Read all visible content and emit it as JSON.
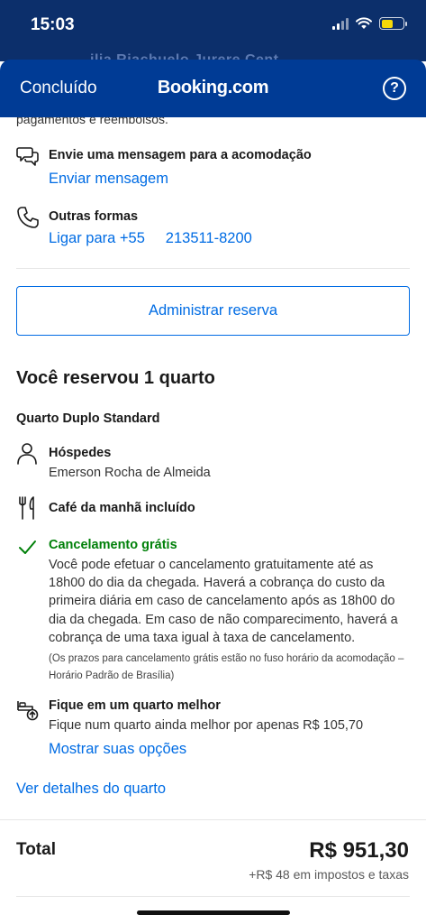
{
  "status_bar": {
    "time": "15:03",
    "peek_text": "ilia Riachuelo Jurere Cent",
    "battery_color": "#f5d90a"
  },
  "navbar": {
    "done_label": "Concluído",
    "logo_text": "Booking.com",
    "help_label": "?",
    "background": "#003b95"
  },
  "cut_text": "pagamentos e reembolsos.",
  "contact": {
    "message": {
      "icon": "chat-bubbles-icon",
      "title": "Envie uma mensagem para a acomodação",
      "link": "Enviar mensagem"
    },
    "phone": {
      "icon": "phone-icon",
      "title": "Outras formas",
      "link": "Ligar para +55     213511-8200"
    }
  },
  "manage_button": "Administrar reserva",
  "reservation": {
    "heading": "Você reservou 1 quarto",
    "room_type": "Quarto Duplo Standard",
    "guests": {
      "icon": "person-icon",
      "title": "Hóspedes",
      "value": "Emerson Rocha de Almeida"
    },
    "breakfast": {
      "icon": "fork-knife-icon",
      "title": "Café da manhã incluído"
    },
    "cancellation": {
      "icon": "checkmark-icon",
      "title": "Cancelamento grátis",
      "body": "Você pode efetuar o cancelamento gratuitamente até as 18h00 do dia da chegada. Haverá a cobrança do custo da primeira diária em caso de cancelamento após as 18h00 do dia da chegada. Em caso de não comparecimento, haverá a cobrança de uma taxa igual à taxa de cancelamento.",
      "note": "(Os prazos para cancelamento grátis estão no fuso horário da acomodação – Horário Padrão de Brasília)",
      "color": "#008009"
    },
    "upgrade": {
      "icon": "bed-upgrade-icon",
      "title": "Fique em um quarto melhor",
      "text": "Fique num quarto ainda melhor por apenas R$ 105,70",
      "link": "Mostrar suas opções"
    },
    "details_link": "Ver detalhes do quarto"
  },
  "total": {
    "label": "Total",
    "price": "R$ 951,30",
    "taxes": "+R$ 48 em impostos e taxas"
  },
  "colors": {
    "link": "#006ce4",
    "header_dark": "#0c2f6b"
  }
}
